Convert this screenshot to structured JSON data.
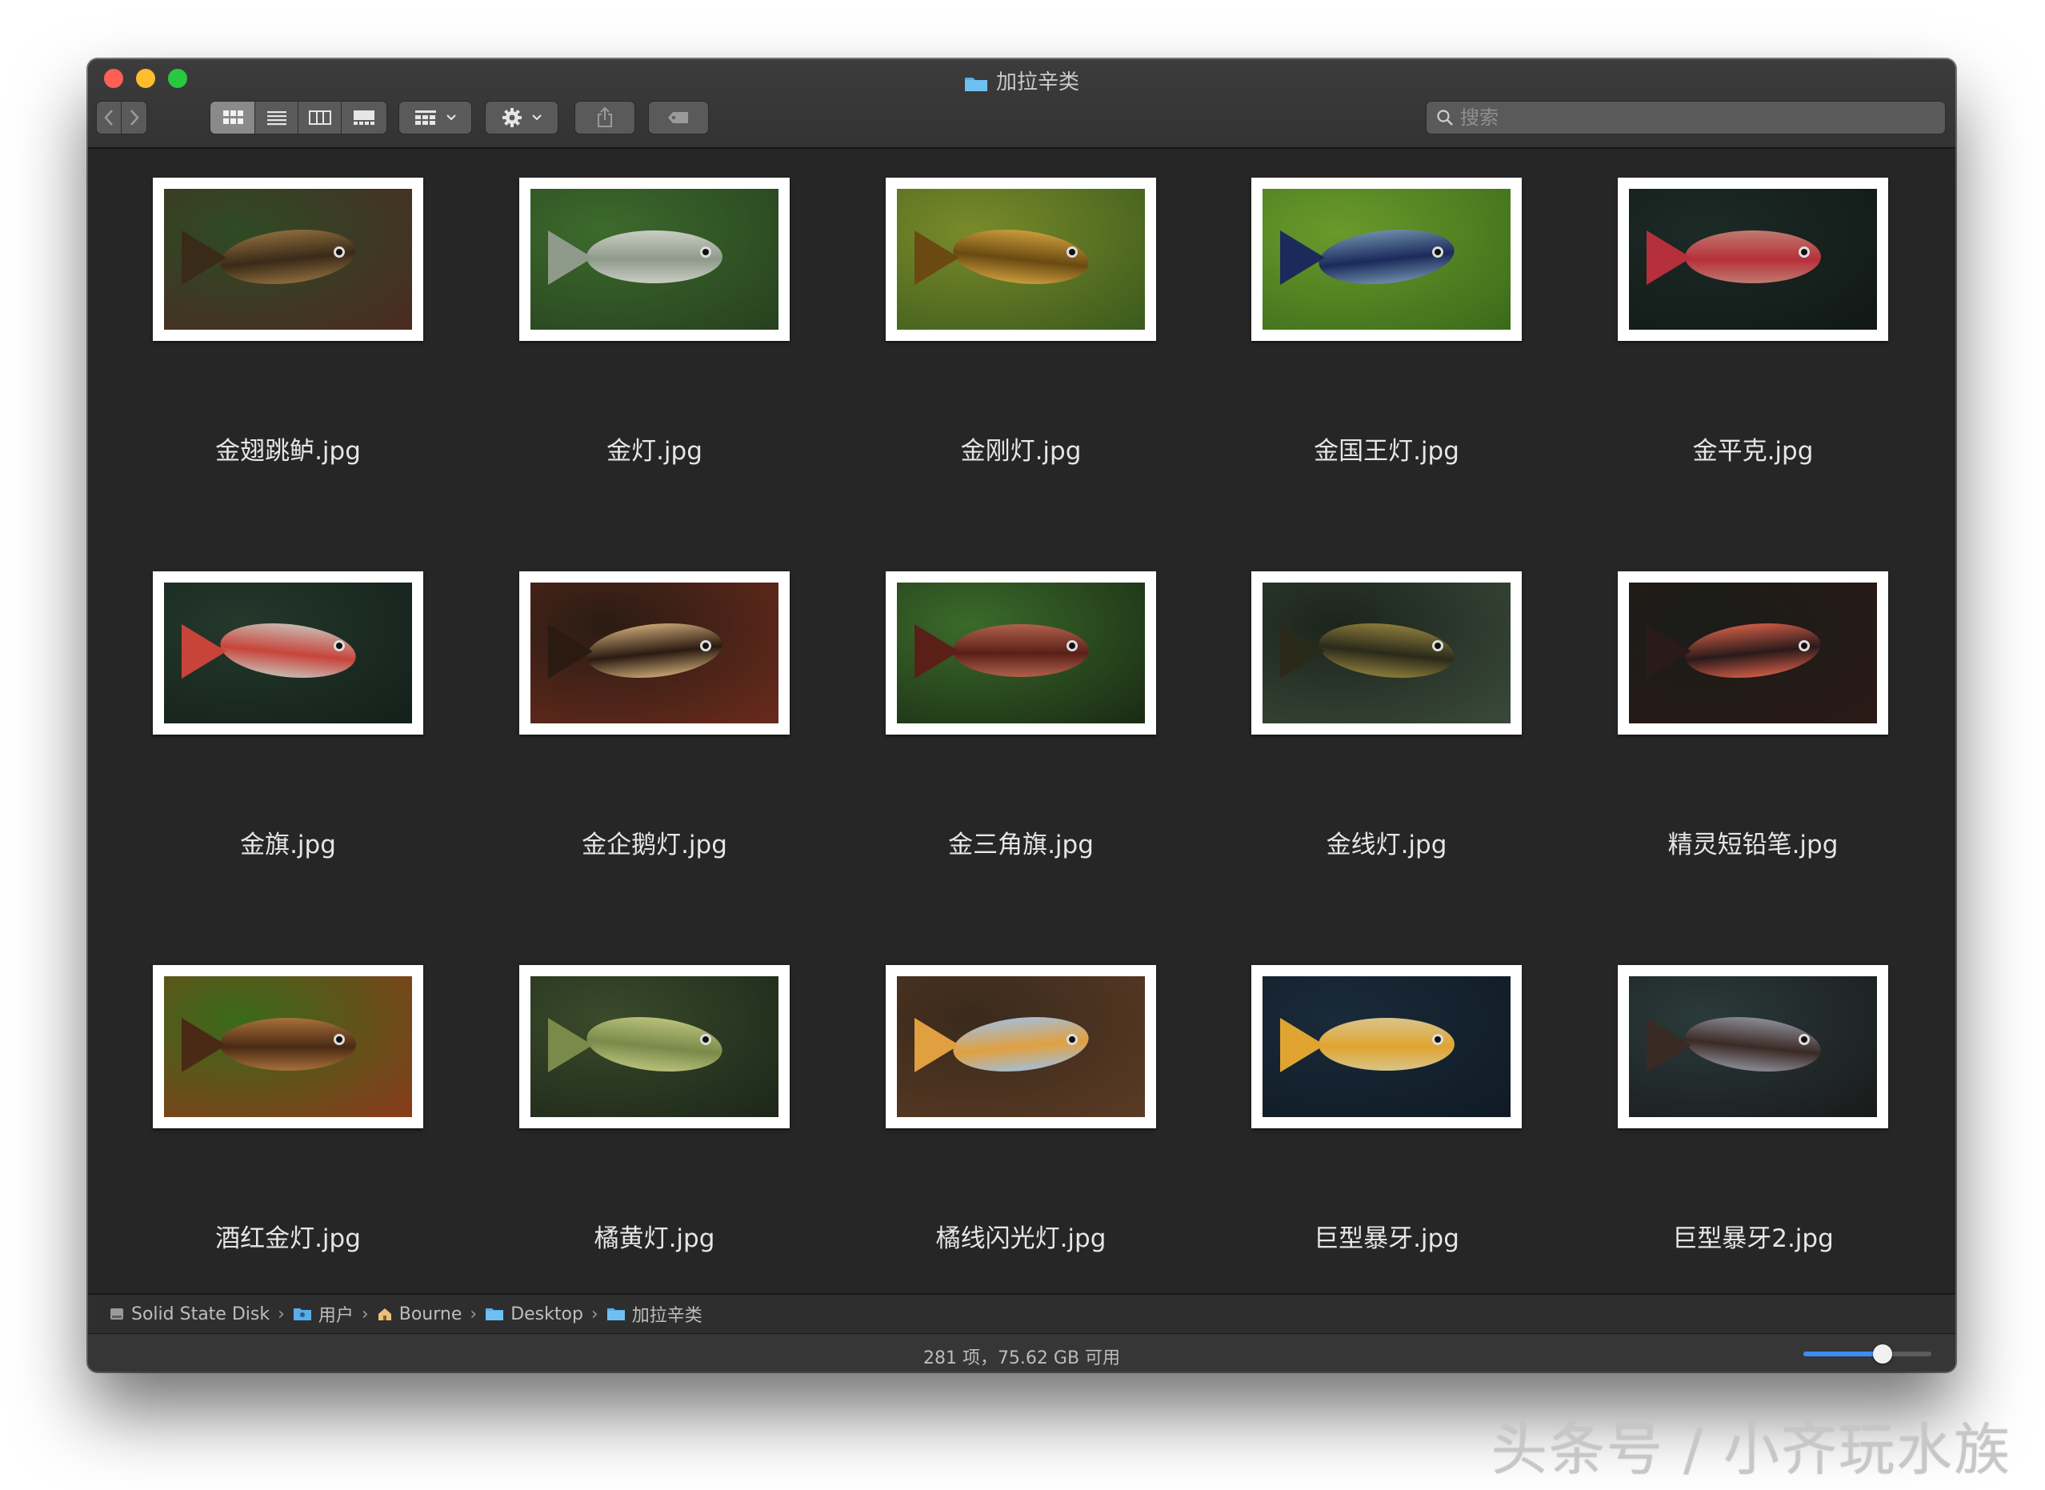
{
  "window": {
    "title": "加拉辛类"
  },
  "toolbar": {
    "back_icon": "chevron-left-icon",
    "forward_icon": "chevron-right-icon",
    "view_modes": [
      "icon-view-icon",
      "list-view-icon",
      "column-view-icon",
      "gallery-view-icon"
    ],
    "active_view_mode": "icon-view-icon",
    "group_icon": "grid-group-icon",
    "action_icon": "gear-icon",
    "share_icon": "share-icon",
    "tag_icon": "tag-icon"
  },
  "search": {
    "placeholder": "搜索",
    "value": ""
  },
  "files": [
    {
      "name": "金翅跳鲈.jpg",
      "bg": [
        "#2f4a25",
        "#4b2a22"
      ],
      "fish": "#8a6a3c",
      "accent": "#3a2a18"
    },
    {
      "name": "金灯.jpg",
      "bg": [
        "#3c6a2c",
        "#27401f"
      ],
      "fish": "#c9cdc3",
      "accent": "#8f9a8a"
    },
    {
      "name": "金刚灯.jpg",
      "bg": [
        "#7a8a2a",
        "#3a5a1c"
      ],
      "fish": "#c89a3a",
      "accent": "#6a4a12"
    },
    {
      "name": "金国王灯.jpg",
      "bg": [
        "#6a9a2a",
        "#3a6a1a"
      ],
      "fish": "#6a8aa8",
      "accent": "#1b2a5a"
    },
    {
      "name": "金平克.jpg",
      "bg": [
        "#1c2a26",
        "#111815"
      ],
      "fish": "#c07a70",
      "accent": "#b5303a"
    },
    {
      "name": "金旗.jpg",
      "bg": [
        "#25382c",
        "#12201a"
      ],
      "fish": "#c9b6ae",
      "accent": "#c8443a"
    },
    {
      "name": "金企鹅灯.jpg",
      "bg": [
        "#2a1c14",
        "#6a2a1c"
      ],
      "fish": "#c2a070",
      "accent": "#2a1a10"
    },
    {
      "name": "金三角旗.jpg",
      "bg": [
        "#3a6a2a",
        "#1a2a14"
      ],
      "fish": "#b0604a",
      "accent": "#5a2018"
    },
    {
      "name": "金线灯.jpg",
      "bg": [
        "#1c241c",
        "#3a4a3a"
      ],
      "fish": "#8a7a3a",
      "accent": "#2a2a1a"
    },
    {
      "name": "精灵短铅笔.jpg",
      "bg": [
        "#1a1c18",
        "#2a1a16"
      ],
      "fish": "#c85a44",
      "accent": "#2a1a1a"
    },
    {
      "name": "酒红金灯.jpg",
      "bg": [
        "#3a6a1a",
        "#8a3a1a"
      ],
      "fish": "#a8703a",
      "accent": "#4a2a14"
    },
    {
      "name": "橘黄灯.jpg",
      "bg": [
        "#3a4a2a",
        "#1c261a"
      ],
      "fish": "#b8c07a",
      "accent": "#7a8a4a"
    },
    {
      "name": "橘线闪光灯.jpg",
      "bg": [
        "#3a2a1c",
        "#5a3a24"
      ],
      "fish": "#a8bcd0",
      "accent": "#e0a040"
    },
    {
      "name": "巨型暴牙.jpg",
      "bg": [
        "#1a2a3a",
        "#0f1a24"
      ],
      "fish": "#d8c48a",
      "accent": "#e0a430"
    },
    {
      "name": "巨型暴牙2.jpg",
      "bg": [
        "#2a3a3a",
        "#1a1a1a"
      ],
      "fish": "#8a8a94",
      "accent": "#3a2a24"
    }
  ],
  "pathbar": {
    "items": [
      {
        "label": "Solid State Disk",
        "icon": "disk-icon"
      },
      {
        "label": "用户",
        "icon": "users-folder-icon"
      },
      {
        "label": "Bourne",
        "icon": "home-icon"
      },
      {
        "label": "Desktop",
        "icon": "folder-icon"
      },
      {
        "label": "加拉辛类",
        "icon": "folder-icon"
      }
    ]
  },
  "status": {
    "text": "281 项，75.62 GB 可用",
    "icon_size_fraction": 0.62
  },
  "watermark": "头条号 / 小齐玩水族",
  "colors": {
    "window_bg": "#262626",
    "accent": "#3a8ef6",
    "folder": "#5aaee8"
  }
}
